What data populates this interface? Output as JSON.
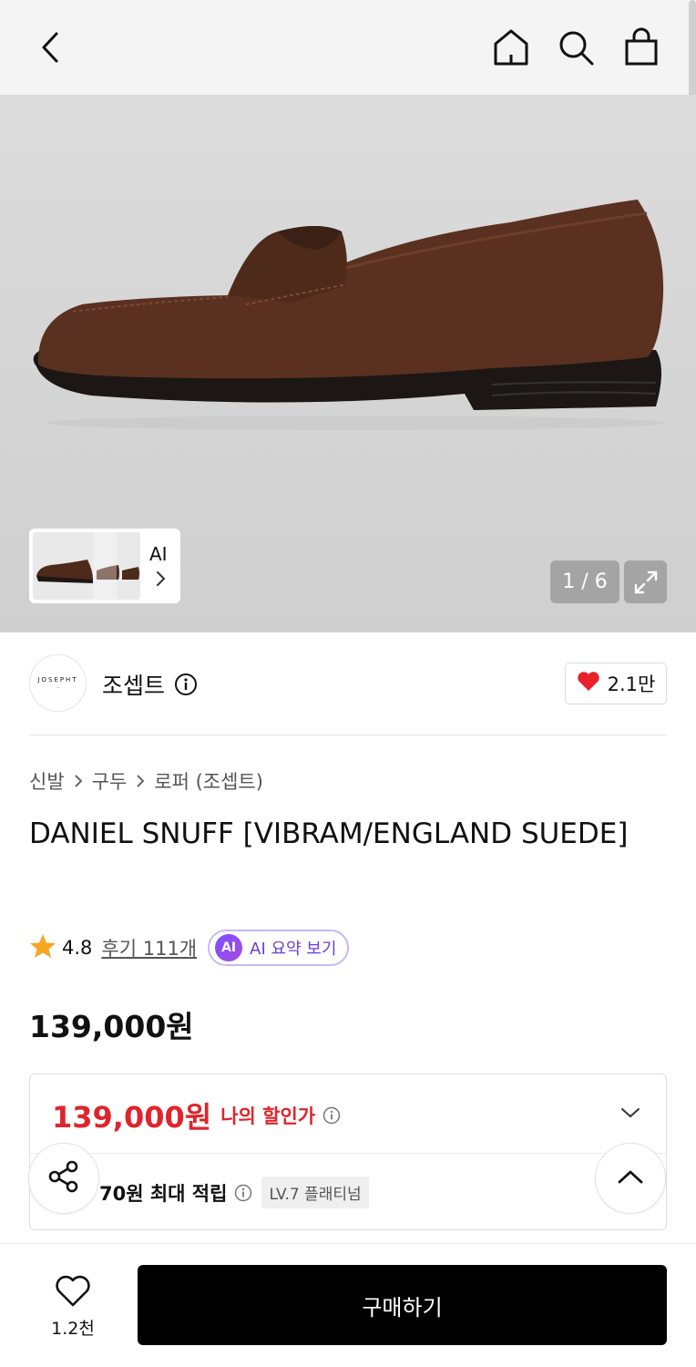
{
  "header": {
    "icons": [
      "back-icon",
      "home-icon",
      "search-icon",
      "bag-icon"
    ]
  },
  "gallery": {
    "counter": "1 / 6",
    "thumb_badge": "AI"
  },
  "brand": {
    "logo_text": "JOSEPHT",
    "name": "조셉트",
    "likes": "2.1만"
  },
  "breadcrumb": [
    "신발",
    "구두",
    "로퍼 (조셉트)"
  ],
  "product": {
    "title": "DANIEL SNUFF [VIBRAM/ENGLAND SUEDE]",
    "rating": "4.8",
    "reviews": "후기 111개",
    "ai_summary": "AI 요약 보기",
    "ai_badge": "AI",
    "price": "139,000원"
  },
  "discount": {
    "price": "139,000원",
    "label": "나의 할인가",
    "points": "70원 최대 적립",
    "level": "LV.7 플래티넘"
  },
  "bottom": {
    "wish_count": "1.2천",
    "buy_label": "구매하기"
  },
  "colors": {
    "accent_red": "#e0242c",
    "ai_purple": "#6b3fd8",
    "star": "#f5a623",
    "heart": "#e8202a"
  }
}
